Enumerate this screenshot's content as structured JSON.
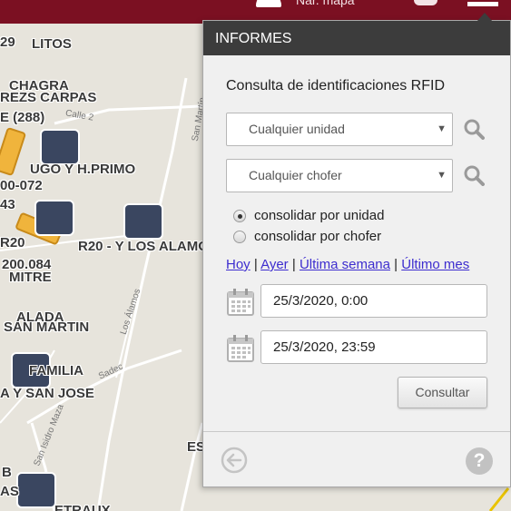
{
  "topbar": {
    "map_label": "Ñar. mapa"
  },
  "map": {
    "labels": [
      "29",
      "LITOS",
      "CHAGRA",
      "REZ",
      "S CARPAS",
      "E (288)",
      "UGO Y H.PRIMO",
      "00-072",
      "43",
      "R20",
      "R20 - Y LOS ALAMO",
      "200.084",
      "MITRE",
      "ALADA",
      "SAN MARTIN",
      "FAMILIA",
      "A Y SAN JOSE",
      "ES",
      "B",
      "AS",
      "ETRAUX"
    ],
    "streets": [
      "Calle 2",
      "San Martín",
      "Los Álamos",
      "Sadec",
      "San Isidro Maza"
    ]
  },
  "panel": {
    "title": "INFORMES",
    "heading": "Consulta de identificaciones RFID",
    "unit_select": "Cualquier unidad",
    "driver_select": "Cualquier chofer",
    "radios": [
      {
        "label": "consolidar por unidad",
        "checked": true
      },
      {
        "label": "consolidar por chofer",
        "checked": false
      }
    ],
    "links": {
      "today": "Hoy",
      "yesterday": "Ayer",
      "last_week": "Última semana",
      "last_month": "Último mes",
      "separator": "|"
    },
    "date_from": "25/3/2020, 0:00",
    "date_to": "25/3/2020, 23:59",
    "submit": "Consultar",
    "help": "?"
  },
  "colors": {
    "brand": "#7b1022",
    "header": "#3c3c3c",
    "link": "#3d2dcf",
    "truck": "#f0b43c"
  }
}
